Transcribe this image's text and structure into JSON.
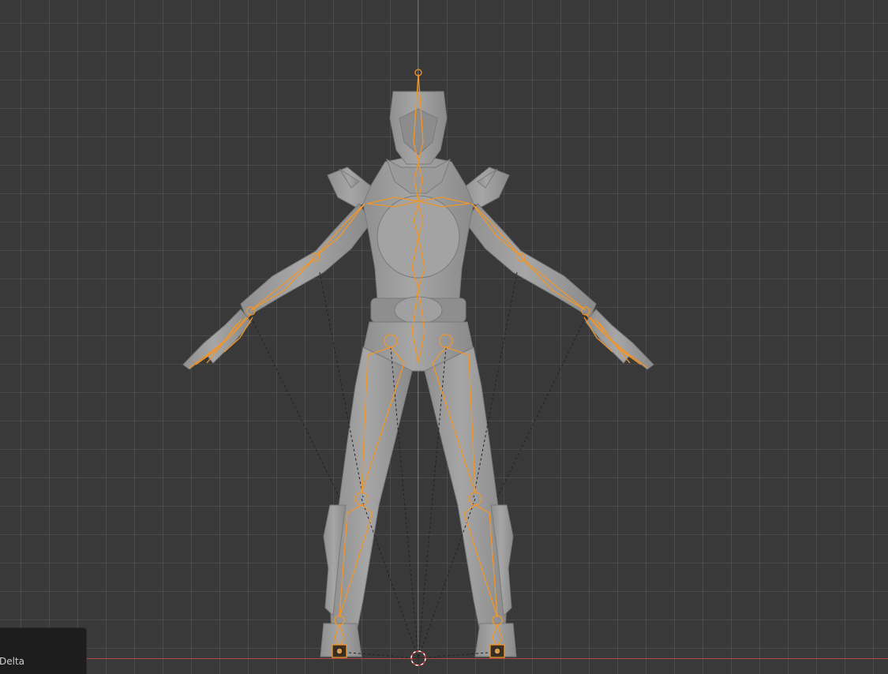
{
  "viewport": {
    "background_color": "#393939",
    "grid_color": "#474747",
    "z_axis_color": "#4f7fb0",
    "x_axis_color": "#b04848"
  },
  "scene": {
    "mesh": {
      "name": "character-mesh",
      "color": "#9d9d9d"
    },
    "armature": {
      "name": "armature",
      "selected_color": "#f0962c"
    },
    "origin_marker": {
      "name": "3d-cursor-icon"
    }
  },
  "last_operation_panel": {
    "label": "Delta"
  }
}
